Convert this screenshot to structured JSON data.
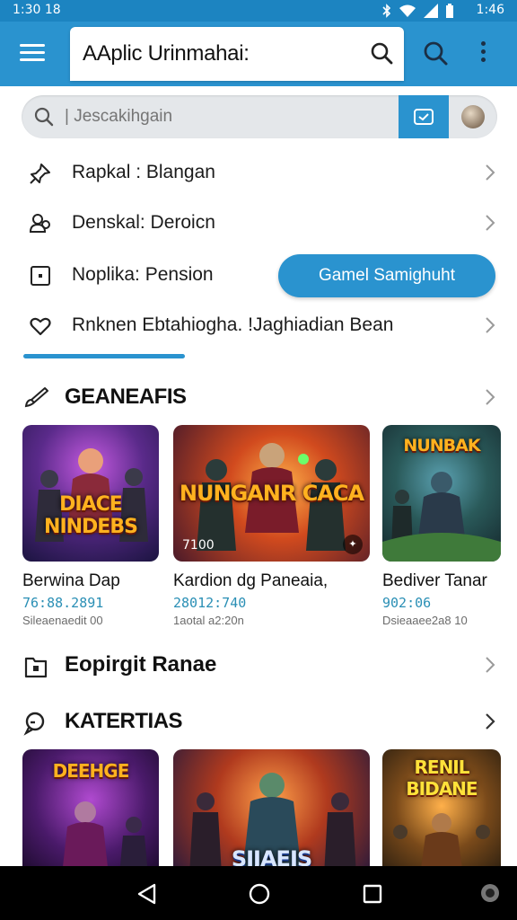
{
  "status_bar": {
    "time_left": "1:30 18",
    "time_right": "1:46"
  },
  "app_bar": {
    "title": "AAplic Urinmahai:"
  },
  "search": {
    "placeholder": "| Jescakihgain"
  },
  "menu_items": [
    {
      "label": "Rapkal : Blangan",
      "icon": "pin-icon"
    },
    {
      "label": "Denskal: Deroicn",
      "icon": "users-icon"
    },
    {
      "label": "Noplika: Pension",
      "icon": "square-dot-icon"
    },
    {
      "label": "Rnknen Ebtahiogha. !Jaghiadian Bean",
      "icon": "heart-icon"
    }
  ],
  "pill_button": {
    "label": "Gamel Samighuht"
  },
  "section_games": {
    "title": "GEANEAFIS",
    "cards": [
      {
        "art_text": "DIACE NINDEBS",
        "title": "Berwina Dap",
        "sub": "76:88.2891",
        "meta": "Sileaenaedit 00"
      },
      {
        "art_text": "NUNGANR CACA",
        "badge": "7100",
        "title": "Kardion dg Paneaia,",
        "sub": "28012:740",
        "meta": "1aotal a2:20n"
      },
      {
        "art_text": "NUNBAK",
        "title": "Bediver Tanar",
        "sub": "902:06",
        "meta": "Dsieaaee2a8 10"
      }
    ]
  },
  "section_copyright": {
    "title": "Eopirgit Ranae"
  },
  "section_kategories": {
    "title": "KATERTIAS",
    "cards": [
      {
        "art_text": "DEEHGE"
      },
      {
        "art_text": "SIJAEIS"
      },
      {
        "art_text": "RENIL BIDANE"
      }
    ]
  },
  "colors": {
    "accent": "#2a93cf",
    "status_bar": "#1c84c1"
  }
}
